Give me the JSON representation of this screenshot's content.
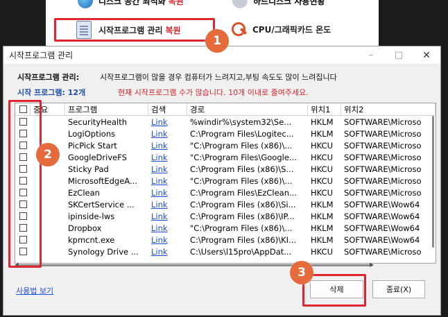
{
  "background": {
    "top_left_label": "디스크 공간 최적화",
    "top_left_suffix": "복원",
    "top_right_label": "하드디스크 사용현황",
    "main_left_label": "시작프로그램 관리",
    "main_left_suffix": "복원",
    "main_right_label": "CPU/그래픽카드 온도"
  },
  "badges": [
    "1",
    "2",
    "3"
  ],
  "dialog": {
    "title": "시작프로그램 관리",
    "minimize": "–",
    "maximize": "□",
    "close": "✕",
    "info_label": "시작프로그램 관리:",
    "info_desc": "시작프로그램이 많을 경우 컴퓨터가 느려지고,부팅 속도도 많이 느려집니다",
    "count_label": "시작 프로그램: 12개",
    "warning": "현재 시작프로그램 수가 많습니다. 10개 이내로 줄여주세요.",
    "columns": [
      "",
      "중요",
      "프로그램",
      "검색",
      "경로",
      "위치1",
      "위치2"
    ],
    "rows": [
      {
        "name": "SecurityHealth",
        "link": "Link",
        "path": "%windir%\\system32\\Se...",
        "loc1": "HKLM",
        "loc2": "SOFTWARE\\Microso"
      },
      {
        "name": "LogiOptions",
        "link": "Link",
        "path": "C:\\Program Files\\Logitec...",
        "loc1": "HKLM",
        "loc2": "SOFTWARE\\Microso"
      },
      {
        "name": "PicPick Start",
        "link": "Link",
        "path": "\"C:\\Program Files (x86)\\...",
        "loc1": "HKCU",
        "loc2": "SOFTWARE\\Microso"
      },
      {
        "name": "GoogleDriveFS",
        "link": "Link",
        "path": "\"C:\\Program Files\\Google...",
        "loc1": "HKCU",
        "loc2": "SOFTWARE\\Microso"
      },
      {
        "name": "Sticky Pad",
        "link": "Link",
        "path": "C:\\Program Files (x86)\\S...",
        "loc1": "HKCU",
        "loc2": "SOFTWARE\\Microso"
      },
      {
        "name": "MicrosoftEdgeA...",
        "link": "Link",
        "path": "\"C:\\Program Files (x86)\\...",
        "loc1": "HKCU",
        "loc2": "SOFTWARE\\Microso"
      },
      {
        "name": "EzClean",
        "link": "Link",
        "path": "C:\\Program Files\\EzClean...",
        "loc1": "HKCU",
        "loc2": "SOFTWARE\\Microso"
      },
      {
        "name": "SKCertService ...",
        "link": "Link",
        "path": "C:\\Program Files (x86)\\Si...",
        "loc1": "HKLM",
        "loc2": "SOFTWARE\\Wow64"
      },
      {
        "name": "ipinside-lws",
        "link": "Link",
        "path": "C:\\Program Files (x86)\\IP...",
        "loc1": "HKLM",
        "loc2": "SOFTWARE\\Wow64"
      },
      {
        "name": "Dropbox",
        "link": "Link",
        "path": "\"C:\\Program Files (x86)\\...",
        "loc1": "HKLM",
        "loc2": "SOFTWARE\\Wow64"
      },
      {
        "name": "kpmcnt.exe",
        "link": "Link",
        "path": "C:\\Program Files (x86)\\KI...",
        "loc1": "HKLM",
        "loc2": "SOFTWARE\\Wow64"
      },
      {
        "name": "Synology Drive ...",
        "link": "Link",
        "path": "C:\\Users\\l15pro\\AppDat...",
        "loc1": "HKCU",
        "loc2": "SOFTWARE\\Microso"
      }
    ],
    "usage_link": "사용법 보기",
    "delete_button": "삭제",
    "close_button": "종료(X)"
  }
}
